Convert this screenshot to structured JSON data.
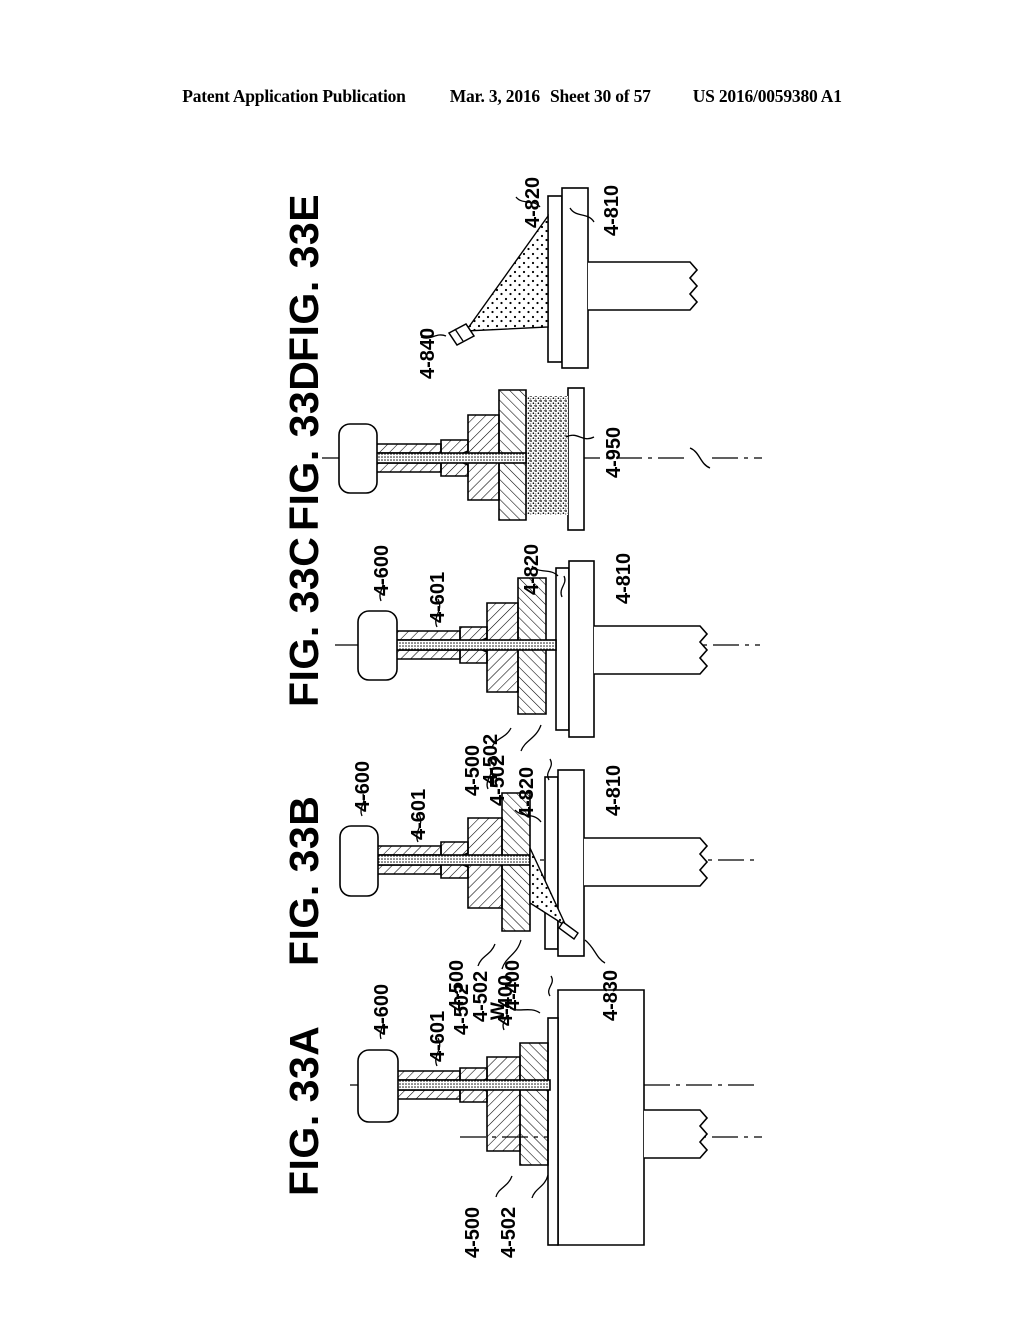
{
  "header": {
    "publication": "Patent Application Publication",
    "date": "Mar. 3, 2016",
    "sheet": "Sheet 30 of 57",
    "patent_number": "US 2016/0059380 A1"
  },
  "figures": [
    {
      "id": "fig-33a",
      "label": "FIG. 33A"
    },
    {
      "id": "fig-33b",
      "label": "FIG. 33B"
    },
    {
      "id": "fig-33c",
      "label": "FIG. 33C"
    },
    {
      "id": "fig-33d",
      "label": "FIG. 33D"
    },
    {
      "id": "fig-33e",
      "label": "FIG. 33E"
    }
  ],
  "reference_numerals": {
    "fig_33a": [
      {
        "key": "a_600",
        "text": "4-600"
      },
      {
        "key": "a_601",
        "text": "4-601"
      },
      {
        "key": "a_502t",
        "text": "4-502"
      },
      {
        "key": "a_400",
        "text": "4-400"
      },
      {
        "key": "a_w",
        "text": "W"
      },
      {
        "key": "a_500",
        "text": "4-500"
      },
      {
        "key": "a_502b",
        "text": "4-502"
      }
    ],
    "fig_33b": [
      {
        "key": "b_600",
        "text": "4-600"
      },
      {
        "key": "b_601",
        "text": "4-601"
      },
      {
        "key": "b_502t",
        "text": "4-502"
      },
      {
        "key": "b_820",
        "text": "4-820"
      },
      {
        "key": "b_810",
        "text": "4-810"
      },
      {
        "key": "b_500",
        "text": "4-500"
      },
      {
        "key": "b_502b",
        "text": "4-502"
      },
      {
        "key": "b_400",
        "text": "4-400"
      },
      {
        "key": "b_830",
        "text": "4-830"
      }
    ],
    "fig_33c": [
      {
        "key": "c_600",
        "text": "4-600"
      },
      {
        "key": "c_601",
        "text": "4-601"
      },
      {
        "key": "c_820",
        "text": "4-820"
      },
      {
        "key": "c_810",
        "text": "4-810"
      },
      {
        "key": "c_500",
        "text": "4-500"
      },
      {
        "key": "c_502",
        "text": "4-502"
      }
    ],
    "fig_33d": [
      {
        "key": "d_950",
        "text": "4-950"
      }
    ],
    "fig_33e": [
      {
        "key": "e_820",
        "text": "4-820"
      },
      {
        "key": "e_810",
        "text": "4-810"
      },
      {
        "key": "e_840",
        "text": "4-840"
      }
    ]
  },
  "colors": {
    "ink": "#000000",
    "paper": "#ffffff"
  }
}
